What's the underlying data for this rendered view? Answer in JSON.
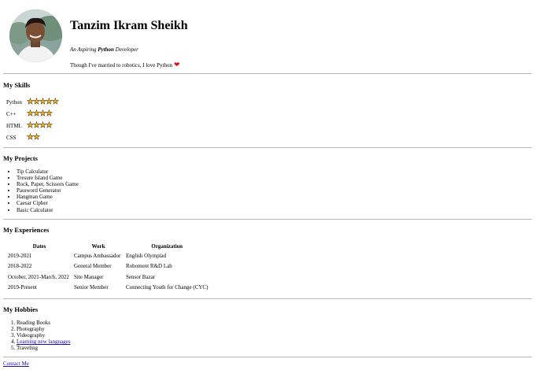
{
  "profile": {
    "name": "Tanzim Ikram Sheikh",
    "tagline_prefix": "An Aspiring ",
    "tagline_bold": "Python",
    "tagline_suffix": " Developer",
    "bio": "Though I've married to robotics, I love Python",
    "heart": "❤"
  },
  "skills": {
    "title": "My Skills",
    "items": [
      {
        "label": "Python",
        "stars": 5
      },
      {
        "label": "C++",
        "stars": 4
      },
      {
        "label": "HTML",
        "stars": 4
      },
      {
        "label": "CSS",
        "stars": 2
      }
    ]
  },
  "projects": {
    "title": "My Projects",
    "items": [
      "Tip Calculator",
      "Tresure Island Game",
      "Rock, Paper, Scissors Game",
      "Password Generator",
      "Hangman Game",
      "Caesar Cipher",
      "Basic Calculator"
    ]
  },
  "experiences": {
    "title": "My Experiences",
    "headers": [
      "Dates",
      "Work",
      "Organization"
    ],
    "rows": [
      [
        "2019-2021",
        "Campus Ambassador",
        "English Olympiad"
      ],
      [
        "2018-2022",
        "General Member",
        "Roboment R&D Lab"
      ],
      [
        "October, 2021-March, 2022",
        "Site Manager",
        "Sensor Bazar"
      ],
      [
        "2019-Present",
        "Senior Member",
        "Connecting Youth for Change (CYC)"
      ]
    ]
  },
  "hobbies": {
    "title": "My Hobbies",
    "items": [
      "Reading Books",
      "Photography",
      "Videography",
      "Learning new languages",
      "Traveling"
    ]
  },
  "contact": {
    "label": "Contact Me"
  },
  "colors": {
    "link": "#1a0dab",
    "heart": "#d8141c",
    "star": "#f2b62a",
    "divider": "#b9b9b9"
  }
}
